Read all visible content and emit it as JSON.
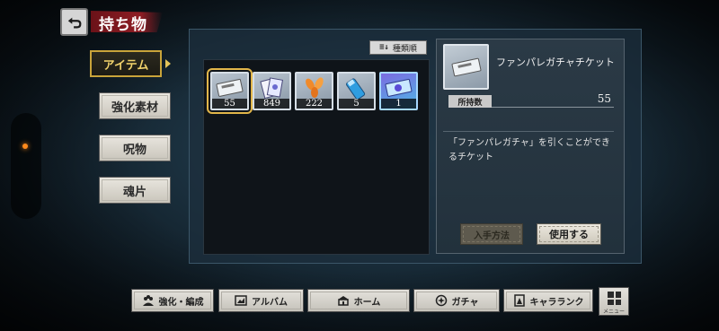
{
  "header": {
    "title": "持ち物"
  },
  "categories": [
    {
      "label": "アイテム",
      "active": true
    },
    {
      "label": "強化素材",
      "active": false
    },
    {
      "label": "呪物",
      "active": false
    },
    {
      "label": "魂片",
      "active": false
    }
  ],
  "sort": {
    "label": "種類順"
  },
  "items": [
    {
      "icon": "ticket-icon",
      "count": "55",
      "selected": true
    },
    {
      "icon": "cards-icon",
      "count": "849"
    },
    {
      "icon": "petals-icon",
      "count": "222"
    },
    {
      "icon": "potion-icon",
      "count": "5"
    },
    {
      "icon": "rare-ticket-icon",
      "count": "1",
      "rare": true
    }
  ],
  "detail": {
    "name": "ファンパレガチャチケット",
    "owned_label": "所持数",
    "owned_value": "55",
    "description_line1": "「ファンパレガチャ」を引くことができ",
    "description_line2": "るチケット",
    "obtain_label": "入手方法",
    "use_label": "使用する"
  },
  "bottom_nav": {
    "enhance": "強化・編成",
    "album": "アルバム",
    "home": "ホーム",
    "gacha": "ガチャ",
    "character_rank": "キャラランク",
    "menu": "メニュー"
  },
  "colors": {
    "accent_gold": "#c9a43a",
    "title_red": "#8e1d24",
    "notification": "#ff8a1c"
  }
}
